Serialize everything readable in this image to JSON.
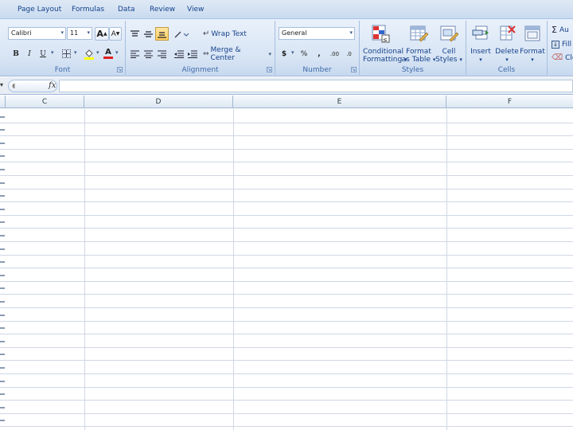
{
  "tabs": [
    "Page Layout",
    "Formulas",
    "Data",
    "Review",
    "View"
  ],
  "font_group": {
    "label": "Font",
    "font_name": "Calibri",
    "font_size": "11",
    "grow_label": "A",
    "shrink_label": "A",
    "bold": "B",
    "italic": "I",
    "underline": "U",
    "font_color_label": "A"
  },
  "alignment_group": {
    "label": "Alignment",
    "wrap_text": "Wrap Text",
    "merge_center": "Merge & Center"
  },
  "number_group": {
    "label": "Number",
    "format": "General",
    "currency": "$",
    "percent": "%",
    "comma": ",",
    "inc_decimal": ".00",
    "dec_decimal": ".0"
  },
  "styles_group": {
    "label": "Styles",
    "conditional": [
      "Conditional",
      "Formatting"
    ],
    "format_table": [
      "Format",
      "as Table"
    ],
    "cell_styles": [
      "Cell",
      "Styles"
    ]
  },
  "cells_group": {
    "label": "Cells",
    "insert": "Insert",
    "delete": "Delete",
    "format": "Format"
  },
  "editing_group": {
    "autosum": "Au",
    "fill": "Fill",
    "clear": "Cle"
  },
  "formula_bar": {
    "fx": "fx",
    "value": ""
  },
  "columns": [
    "C",
    "D",
    "E",
    "F"
  ],
  "colors": {
    "ribbon_text": "#15428b",
    "gridline": "#d0d7e5",
    "highlight": "#ffcf5d",
    "font_color": "#e02020",
    "fill_color": "#ffff00"
  }
}
